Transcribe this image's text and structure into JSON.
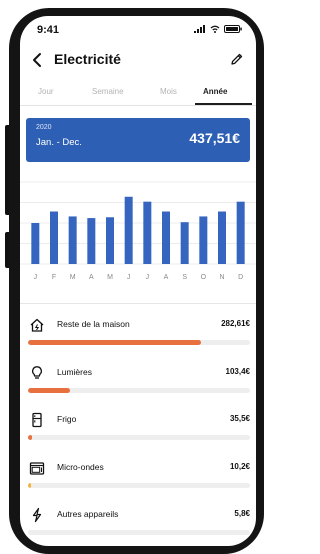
{
  "status": {
    "time": "9:41"
  },
  "header": {
    "title": "Electricité"
  },
  "tabs": [
    {
      "label": "Jour",
      "active": false
    },
    {
      "label": "Semaine",
      "active": false
    },
    {
      "label": "Mois",
      "active": false
    },
    {
      "label": "Année",
      "active": true
    }
  ],
  "summary": {
    "year": "2020",
    "range": "Jan. - Dec.",
    "amount": "437,51€"
  },
  "chart_data": {
    "type": "bar",
    "categories": [
      "J",
      "F",
      "M",
      "A",
      "M",
      "J",
      "J",
      "A",
      "S",
      "O",
      "N",
      "D"
    ],
    "values": [
      50,
      64,
      58,
      56,
      57,
      82,
      76,
      64,
      51,
      58,
      64,
      76
    ],
    "ylim": [
      0,
      100
    ],
    "color": "#3565bf",
    "grid": true
  },
  "categories": [
    {
      "name": "Reste de la maison",
      "value": "282,61€",
      "icon": "house-icon",
      "share": 0.78,
      "color": "#e8703e"
    },
    {
      "name": "Lumières",
      "value": "103,4€",
      "icon": "lightbulb-icon",
      "share": 0.19,
      "color": "#e8703e"
    },
    {
      "name": "Frigo",
      "value": "35,5€",
      "icon": "fridge-icon",
      "share": 0.02,
      "color": "#e8703e"
    },
    {
      "name": "Micro-ondes",
      "value": "10,2€",
      "icon": "microwave-icon",
      "share": 0.01,
      "color": "#f3b23a"
    },
    {
      "name": "Autres appareils",
      "value": "5,8€",
      "icon": "lightning-icon",
      "share": 0.0,
      "color": "#f3b23a"
    }
  ]
}
